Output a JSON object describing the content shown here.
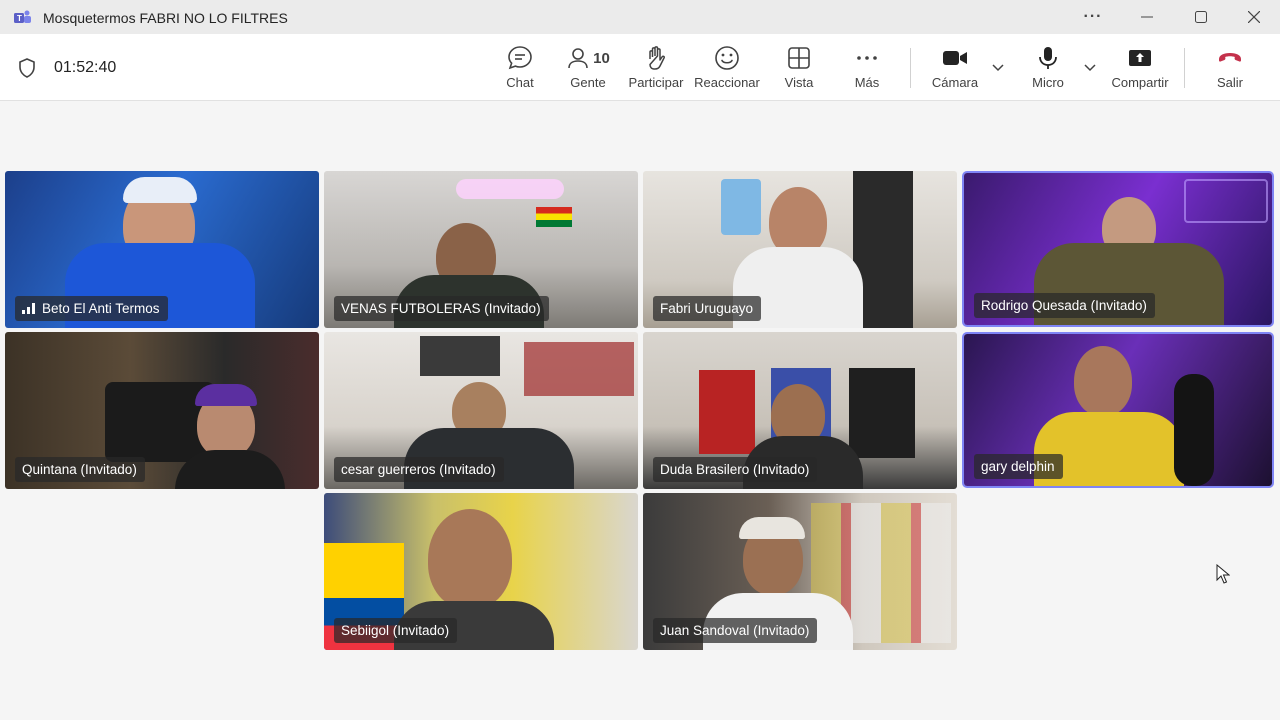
{
  "window": {
    "title": "Mosquetermos FABRI NO LO FILTRES",
    "more_label": "···"
  },
  "meeting": {
    "timer": "01:52:40"
  },
  "toolbar": {
    "chat": "Chat",
    "people": "Gente",
    "people_count": "10",
    "raise": "Participar",
    "react": "Reaccionar",
    "view": "Vista",
    "more": "Más",
    "camera": "Cámara",
    "mic": "Micro",
    "share": "Compartir",
    "leave": "Salir"
  },
  "colors": {
    "accent": "#7f85f5",
    "leave": "#c4314b"
  },
  "participants": [
    {
      "name": "Beto El Anti Termos",
      "speaking": true
    },
    {
      "name": "VENAS FUTBOLERAS (Invitado)"
    },
    {
      "name": "Fabri Uruguayo"
    },
    {
      "name": "Rodrigo Quesada (Invitado)",
      "highlighted": true
    },
    {
      "name": "Quintana (Invitado)"
    },
    {
      "name": "cesar guerreros (Invitado)"
    },
    {
      "name": "Duda Brasilero (Invitado)"
    },
    {
      "name": "gary delphin",
      "highlighted": true
    },
    {
      "name": "Sebiigol (Invitado)"
    },
    {
      "name": "Juan Sandoval (Invitado)"
    }
  ]
}
